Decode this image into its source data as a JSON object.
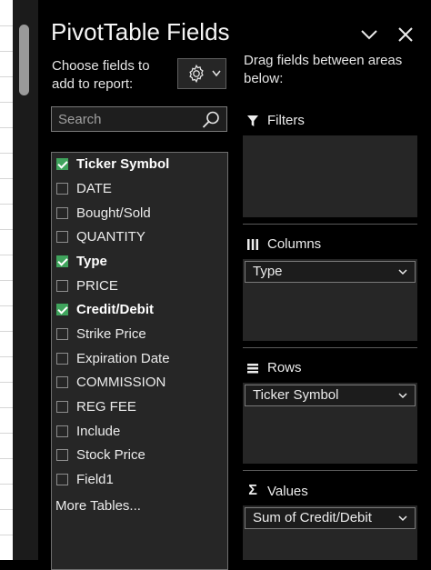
{
  "panel": {
    "title": "PivotTable Fields",
    "choose_text_line1": "Choose fields to",
    "choose_text_line2": "add to report:",
    "search_placeholder": "Search",
    "more_tables": "More Tables...",
    "drag_text_line1": "Drag fields between areas",
    "drag_text_line2": "below:"
  },
  "fields": [
    {
      "label": "Ticker Symbol",
      "checked": true
    },
    {
      "label": "DATE",
      "checked": false
    },
    {
      "label": "Bought/Sold",
      "checked": false
    },
    {
      "label": "QUANTITY",
      "checked": false
    },
    {
      "label": "Type",
      "checked": true
    },
    {
      "label": "PRICE",
      "checked": false
    },
    {
      "label": "Credit/Debit",
      "checked": true
    },
    {
      "label": "Strike Price",
      "checked": false
    },
    {
      "label": "Expiration Date",
      "checked": false
    },
    {
      "label": "COMMISSION",
      "checked": false
    },
    {
      "label": "REG FEE",
      "checked": false
    },
    {
      "label": "Include",
      "checked": false
    },
    {
      "label": "Stock Price",
      "checked": false
    },
    {
      "label": "Field1",
      "checked": false
    }
  ],
  "areas": {
    "filters": {
      "label": "Filters",
      "icon": "filter-icon"
    },
    "columns": {
      "label": "Columns",
      "icon": "columns-icon",
      "item": "Type"
    },
    "rows": {
      "label": "Rows",
      "icon": "rows-icon",
      "item": "Ticker Symbol"
    },
    "values": {
      "label": "Values",
      "icon": "sigma-icon",
      "glyph": "Σ",
      "item": "Sum of Credit/Debit"
    }
  },
  "colors": {
    "accent_check": "#3fa35c",
    "panel_bg": "#000000",
    "box_bg": "#262626"
  }
}
